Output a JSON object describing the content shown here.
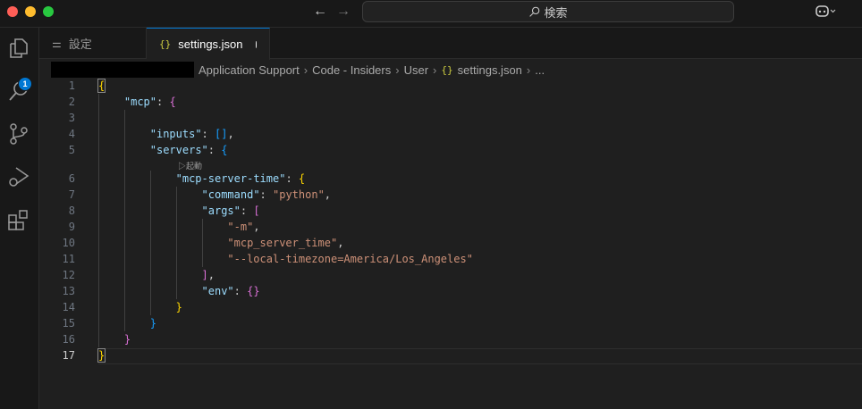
{
  "titlebar": {
    "search_label": "検索",
    "back": "←",
    "forward": "→"
  },
  "activity": {
    "explorer_badge": "1"
  },
  "tabs": [
    {
      "label": "設定"
    },
    {
      "label": "settings.json",
      "icon": "{}"
    }
  ],
  "breadcrumb": [
    "Application Support",
    "Code - Insiders",
    "User",
    "settings.json",
    "..."
  ],
  "codelens": "▷起動",
  "lines": [
    {
      "n": "1",
      "indent": 0,
      "tokens": [
        {
          "t": "{",
          "c": "b1"
        }
      ]
    },
    {
      "n": "2",
      "indent": 1,
      "tokens": [
        {
          "t": "\"mcp\"",
          "c": "k"
        },
        {
          "t": ": ",
          "c": "p"
        },
        {
          "t": "{",
          "c": "b2"
        }
      ]
    },
    {
      "n": "3",
      "indent": 0,
      "tokens": []
    },
    {
      "n": "4",
      "indent": 2,
      "tokens": [
        {
          "t": "\"inputs\"",
          "c": "k"
        },
        {
          "t": ": ",
          "c": "p"
        },
        {
          "t": "[]",
          "c": "b3"
        },
        {
          "t": ",",
          "c": "p"
        }
      ]
    },
    {
      "n": "5",
      "indent": 2,
      "tokens": [
        {
          "t": "\"servers\"",
          "c": "k"
        },
        {
          "t": ": ",
          "c": "p"
        },
        {
          "t": "{",
          "c": "b3"
        }
      ]
    },
    {
      "n": "6",
      "indent": 3,
      "tokens": [
        {
          "t": "\"mcp-server-time\"",
          "c": "k"
        },
        {
          "t": ": ",
          "c": "p"
        },
        {
          "t": "{",
          "c": "b1"
        }
      ]
    },
    {
      "n": "7",
      "indent": 4,
      "tokens": [
        {
          "t": "\"command\"",
          "c": "k"
        },
        {
          "t": ": ",
          "c": "p"
        },
        {
          "t": "\"python\"",
          "c": "s"
        },
        {
          "t": ",",
          "c": "p"
        }
      ]
    },
    {
      "n": "8",
      "indent": 4,
      "tokens": [
        {
          "t": "\"args\"",
          "c": "k"
        },
        {
          "t": ": ",
          "c": "p"
        },
        {
          "t": "[",
          "c": "b2"
        }
      ]
    },
    {
      "n": "9",
      "indent": 5,
      "tokens": [
        {
          "t": "\"-m\"",
          "c": "s"
        },
        {
          "t": ",",
          "c": "p"
        }
      ]
    },
    {
      "n": "10",
      "indent": 5,
      "tokens": [
        {
          "t": "\"mcp_server_time\"",
          "c": "s"
        },
        {
          "t": ",",
          "c": "p"
        }
      ]
    },
    {
      "n": "11",
      "indent": 5,
      "tokens": [
        {
          "t": "\"--local-timezone=America/Los_Angeles\"",
          "c": "s"
        }
      ]
    },
    {
      "n": "12",
      "indent": 4,
      "tokens": [
        {
          "t": "]",
          "c": "b2"
        },
        {
          "t": ",",
          "c": "p"
        }
      ]
    },
    {
      "n": "13",
      "indent": 4,
      "tokens": [
        {
          "t": "\"env\"",
          "c": "k"
        },
        {
          "t": ": ",
          "c": "p"
        },
        {
          "t": "{}",
          "c": "b2"
        }
      ]
    },
    {
      "n": "14",
      "indent": 3,
      "tokens": [
        {
          "t": "}",
          "c": "b1"
        }
      ]
    },
    {
      "n": "15",
      "indent": 2,
      "tokens": [
        {
          "t": "}",
          "c": "b3"
        }
      ]
    },
    {
      "n": "16",
      "indent": 1,
      "tokens": [
        {
          "t": "}",
          "c": "b2"
        }
      ]
    },
    {
      "n": "17",
      "indent": 0,
      "tokens": [
        {
          "t": "}",
          "c": "b1"
        }
      ]
    }
  ]
}
